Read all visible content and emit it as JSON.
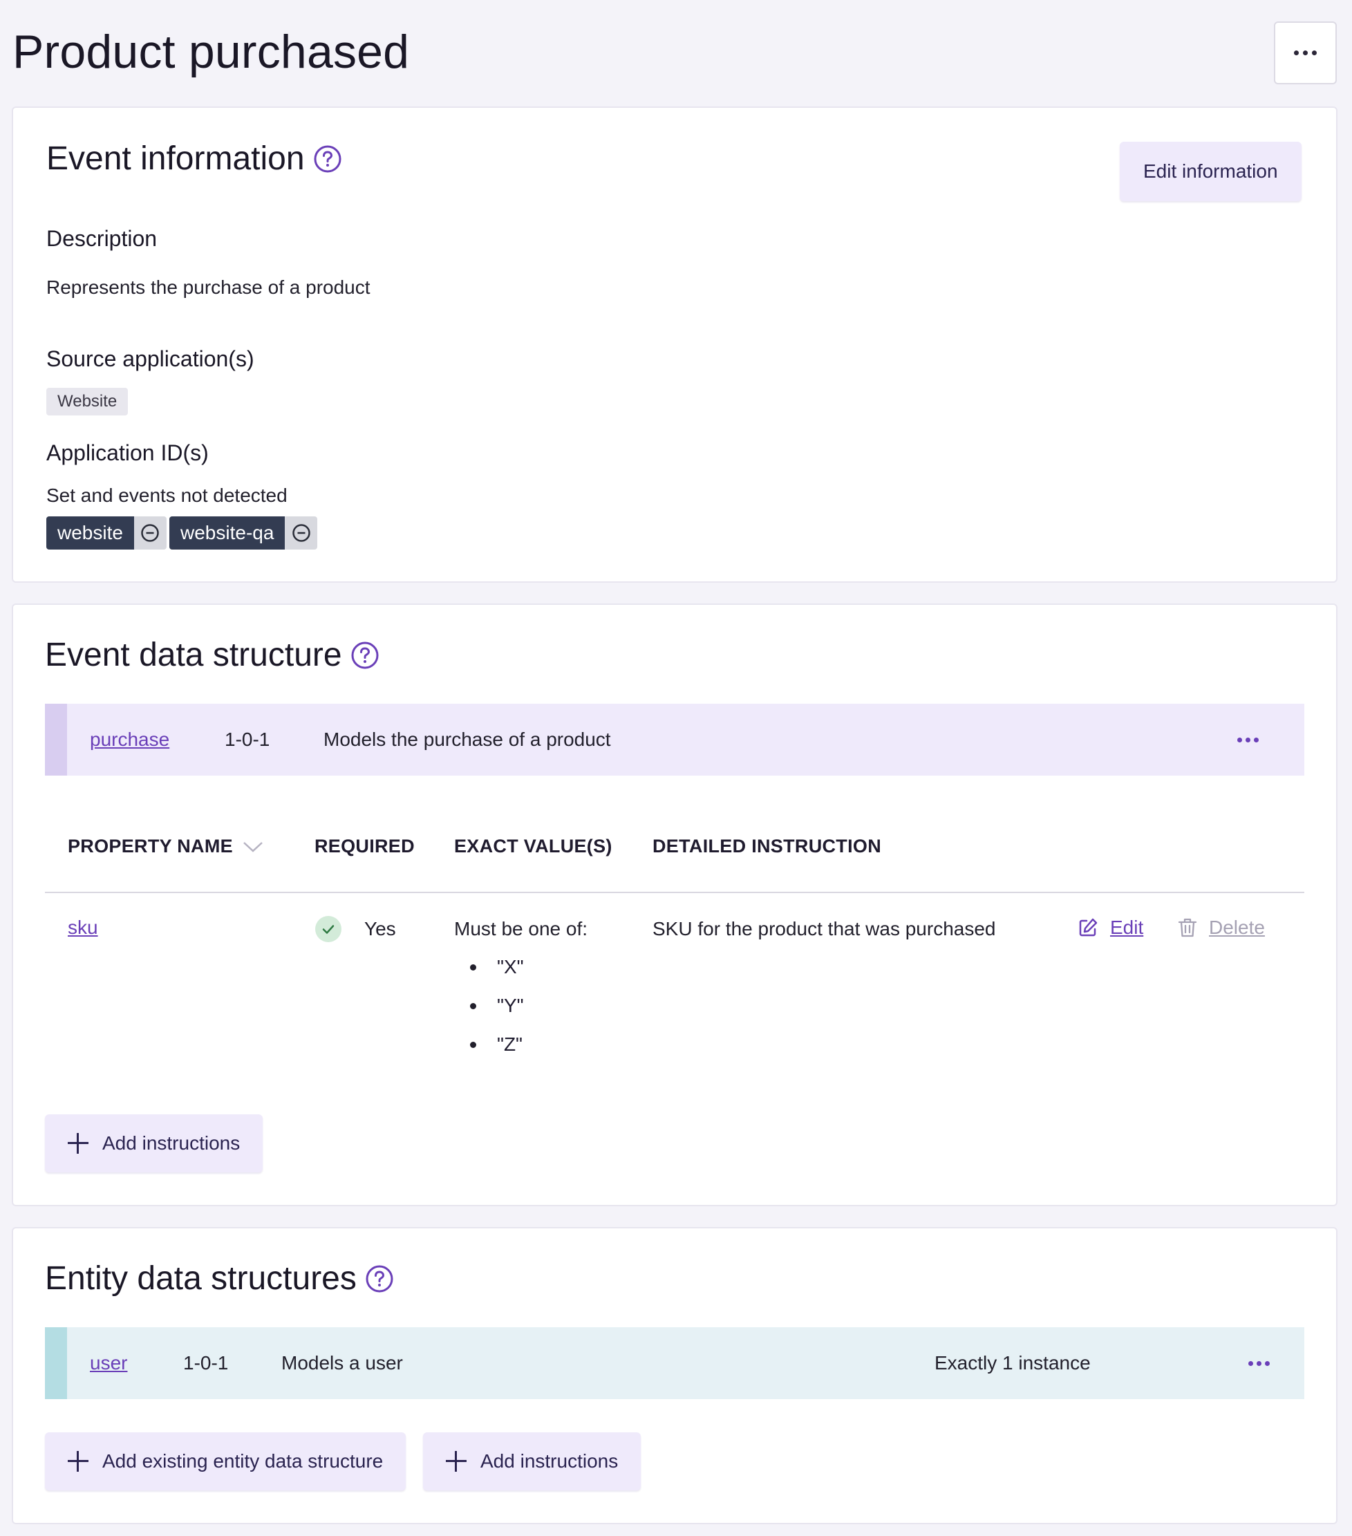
{
  "page": {
    "title": "Product purchased"
  },
  "event_information": {
    "title": "Event information",
    "edit_button": "Edit information",
    "description_label": "Description",
    "description_text": "Represents the purchase of a product",
    "source_apps_label": "Source application(s)",
    "source_apps": [
      "Website"
    ],
    "app_ids_label": "Application ID(s)",
    "app_ids_status": "Set and events not detected",
    "app_ids": [
      "website",
      "website-qa"
    ]
  },
  "event_data_structure": {
    "title": "Event data structure",
    "schema": {
      "name": "purchase",
      "version": "1-0-1",
      "description": "Models the purchase of a product"
    },
    "columns": {
      "property_name": "PROPERTY NAME",
      "required": "REQUIRED",
      "exact_values": "EXACT VALUE(S)",
      "detailed_instruction": "DETAILED INSTRUCTION"
    },
    "rows": [
      {
        "property": "sku",
        "required": "Yes",
        "exact_values_intro": "Must be one of:",
        "exact_values": [
          "\"X\"",
          "\"Y\"",
          "\"Z\""
        ],
        "instruction": "SKU for the product that was purchased",
        "edit_label": "Edit",
        "delete_label": "Delete"
      }
    ],
    "add_instructions": "Add instructions"
  },
  "entity_data_structures": {
    "title": "Entity data structures",
    "entity": {
      "name": "user",
      "version": "1-0-1",
      "description": "Models a user",
      "cardinality": "Exactly 1 instance"
    },
    "add_existing_button": "Add existing entity data structure",
    "add_instructions": "Add instructions"
  },
  "colors": {
    "accent_purple": "#6a3fb8",
    "event_row_bg": "#efeafb",
    "event_row_accent": "#d8cdf0",
    "entity_row_bg": "#e6f1f5",
    "entity_row_accent": "#b4dde3"
  },
  "icons": {
    "help": "help-circle-icon",
    "more": "more-horizontal-icon",
    "plus": "plus-icon",
    "edit": "edit-icon",
    "delete": "trash-icon",
    "check": "check-icon",
    "remove": "minus-circle-icon"
  }
}
